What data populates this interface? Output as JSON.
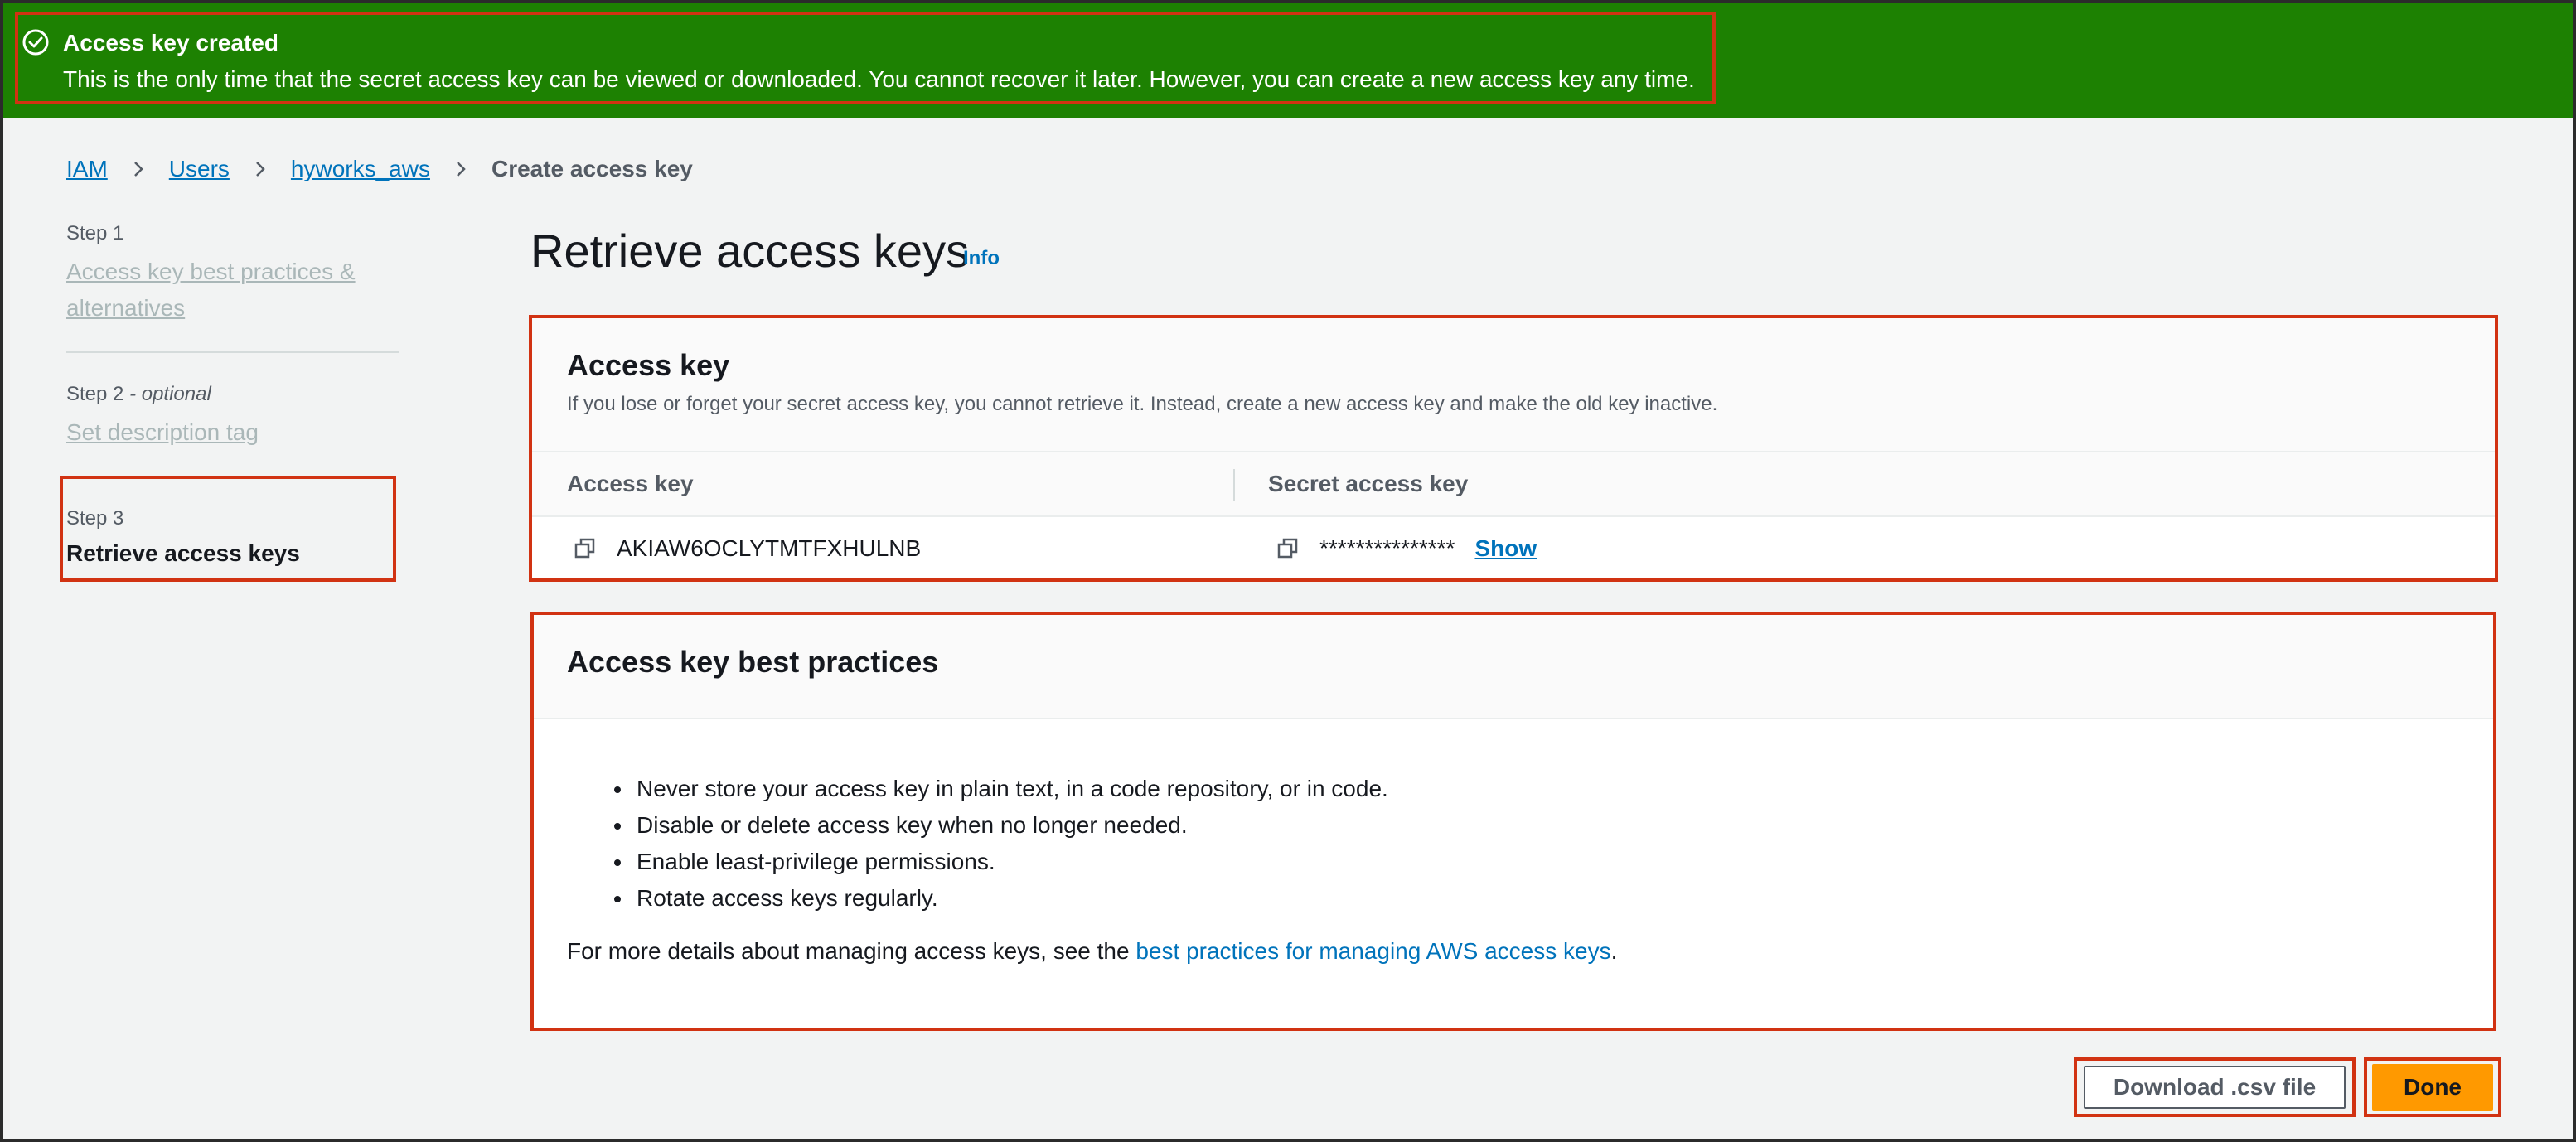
{
  "flash": {
    "title": "Access key created",
    "message": "This is the only time that the secret access key can be viewed or downloaded. You cannot recover it later. However, you can create a new access key any time.",
    "icon": "check-circle-icon"
  },
  "breadcrumb": {
    "items": [
      "IAM",
      "Users",
      "hyworks_aws"
    ],
    "current": "Create access key"
  },
  "steps": {
    "step1": {
      "label": "Step 1",
      "title": "Access key best practices & alternatives"
    },
    "step2": {
      "label": "Step 2",
      "optional": "- optional",
      "title": "Set description tag"
    },
    "step3": {
      "label": "Step 3",
      "title": "Retrieve access keys"
    }
  },
  "page": {
    "title": "Retrieve access keys",
    "info": "Info"
  },
  "access_key": {
    "title": "Access key",
    "description": "If you lose or forget your secret access key, you cannot retrieve it. Instead, create a new access key and make the old key inactive.",
    "columns": [
      "Access key",
      "Secret access key"
    ],
    "access_key_value": "AKIAW6OCLYTMTFXHULNB",
    "secret_masked": "***************",
    "show_label": "Show"
  },
  "best_practices": {
    "title": "Access key best practices",
    "items": [
      "Never store your access key in plain text, in a code repository, or in code.",
      "Disable or delete access key when no longer needed.",
      "Enable least-privilege permissions.",
      "Rotate access keys regularly."
    ],
    "more_prefix": "For more details about managing access keys, see the ",
    "more_link": "best practices for managing AWS access keys",
    "more_suffix": "."
  },
  "buttons": {
    "download": "Download .csv file",
    "done": "Done"
  },
  "colors": {
    "success": "#1d8102",
    "link": "#0073bb",
    "primary": "#ff9900",
    "highlight": "#d13212"
  }
}
